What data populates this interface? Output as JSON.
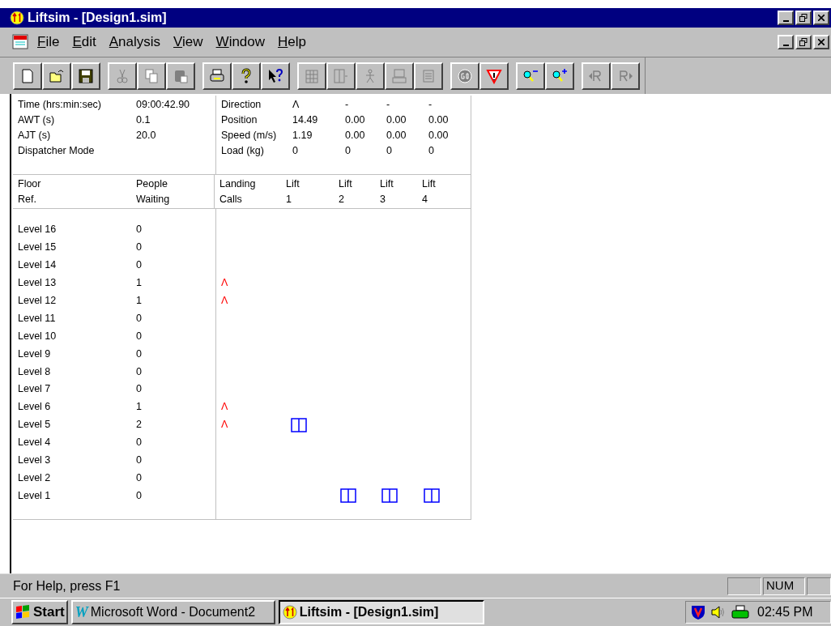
{
  "window": {
    "title": "Liftsim - [Design1.sim]"
  },
  "menu": [
    "File",
    "Edit",
    "Analysis",
    "View",
    "Window",
    "Help"
  ],
  "toolbar": [
    [
      {
        "kind": "new",
        "disabled": false
      },
      {
        "kind": "open",
        "disabled": false
      },
      {
        "kind": "save",
        "disabled": false
      }
    ],
    [
      {
        "kind": "cut",
        "disabled": true
      },
      {
        "kind": "copy",
        "disabled": true
      },
      {
        "kind": "paste",
        "disabled": true
      }
    ],
    [
      {
        "kind": "print",
        "disabled": false
      },
      {
        "kind": "help",
        "disabled": false
      },
      {
        "kind": "context-help",
        "disabled": false
      }
    ],
    [
      {
        "kind": "building",
        "disabled": true
      },
      {
        "kind": "door",
        "disabled": true
      },
      {
        "kind": "person",
        "disabled": true
      },
      {
        "kind": "computer",
        "disabled": true
      },
      {
        "kind": "form",
        "disabled": true
      }
    ],
    [
      {
        "kind": "go",
        "disabled": true
      },
      {
        "kind": "warning",
        "disabled": false
      }
    ],
    [
      {
        "kind": "zoom-out",
        "disabled": false
      },
      {
        "kind": "zoom-in",
        "disabled": false
      }
    ],
    [
      {
        "kind": "prev",
        "disabled": true
      },
      {
        "kind": "next",
        "disabled": true
      }
    ]
  ],
  "summary": [
    {
      "label": "Time (hrs:min:sec)",
      "value": "09:00:42.90"
    },
    {
      "label": "AWT (s)",
      "value": "0.1"
    },
    {
      "label": "AJT (s)",
      "value": "20.0"
    },
    {
      "label": "Dispatcher Mode"
    }
  ],
  "lift_stats": [
    {
      "label": "Direction",
      "values": [
        "Λ",
        "-",
        "-",
        "-"
      ]
    },
    {
      "label": "Position",
      "values": [
        "14.49",
        "0.00",
        "0.00",
        "0.00"
      ]
    },
    {
      "label": "Speed (m/s)",
      "values": [
        "1.19",
        "0.00",
        "0.00",
        "0.00"
      ]
    },
    {
      "label": "Load (kg)",
      "values": [
        "0",
        "0",
        "0",
        "0"
      ]
    }
  ],
  "headers": [
    [
      "Floor",
      "Ref."
    ],
    [
      "People",
      "Waiting"
    ],
    [
      "Landing",
      "Calls"
    ],
    [
      "Lift",
      "1"
    ],
    [
      "Lift",
      "2"
    ],
    [
      "Lift",
      "3"
    ],
    [
      "Lift",
      "4"
    ]
  ],
  "floors": [
    {
      "name": "Level 16",
      "waiting": "0",
      "cars": [
        false,
        false,
        false,
        false
      ]
    },
    {
      "name": "Level 15",
      "waiting": "0",
      "cars": [
        false,
        false,
        false,
        false
      ]
    },
    {
      "name": "Level 14",
      "waiting": "0",
      "cars": [
        false,
        false,
        false,
        false
      ]
    },
    {
      "name": "Level 13",
      "waiting": "1",
      "call": "Λ",
      "cars": [
        false,
        false,
        false,
        false
      ]
    },
    {
      "name": "Level 12",
      "waiting": "1",
      "call": "Λ",
      "cars": [
        false,
        false,
        false,
        false
      ]
    },
    {
      "name": "Level 11",
      "waiting": "0",
      "cars": [
        false,
        false,
        false,
        false
      ]
    },
    {
      "name": "Level 10",
      "waiting": "0",
      "cars": [
        false,
        false,
        false,
        false
      ]
    },
    {
      "name": "Level 9",
      "waiting": "0",
      "cars": [
        false,
        false,
        false,
        false
      ]
    },
    {
      "name": "Level 8",
      "waiting": "0",
      "cars": [
        false,
        false,
        false,
        false
      ]
    },
    {
      "name": "Level 7",
      "waiting": "0",
      "cars": [
        false,
        false,
        false,
        false
      ]
    },
    {
      "name": "Level 6",
      "waiting": "1",
      "call": "Λ",
      "cars": [
        false,
        false,
        false,
        false
      ]
    },
    {
      "name": "Level 5",
      "waiting": "2",
      "call": "Λ",
      "cars": [
        true,
        false,
        false,
        false
      ]
    },
    {
      "name": "Level 4",
      "waiting": "0",
      "cars": [
        false,
        false,
        false,
        false
      ]
    },
    {
      "name": "Level 3",
      "waiting": "0",
      "cars": [
        false,
        false,
        false,
        false
      ]
    },
    {
      "name": "Level 2",
      "waiting": "0",
      "cars": [
        false,
        false,
        false,
        false
      ]
    },
    {
      "name": "Level 1",
      "waiting": "0",
      "cars": [
        false,
        true,
        true,
        true
      ]
    }
  ],
  "status_bar": {
    "text": "For Help, press F1",
    "indicator": "NUM"
  },
  "taskbar": {
    "start": "Start",
    "tasks": [
      {
        "kind": "word",
        "icon": "W",
        "label": "Microsoft Word - Document2",
        "selected": false
      },
      {
        "kind": "liftsim",
        "label": "Liftsim - [Design1.sim]",
        "selected": true
      }
    ],
    "clock": "02:45 PM"
  }
}
